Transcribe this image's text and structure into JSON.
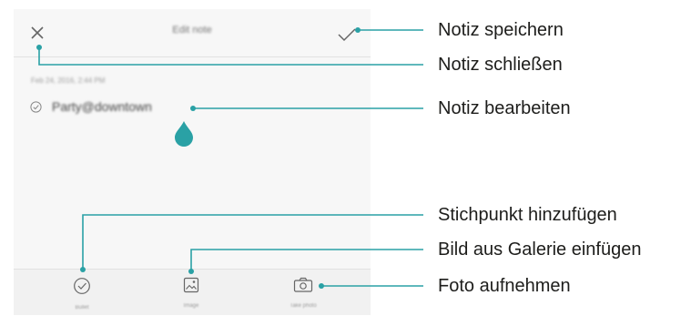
{
  "screen": {
    "title": "Edit note",
    "date": "Feb 24, 2016, 2:44 PM",
    "note_text": "Party@downtown",
    "toolbar": [
      {
        "label": "Bullet",
        "icon": "bullet-check-icon"
      },
      {
        "label": "Image",
        "icon": "image-icon"
      },
      {
        "label": "Take photo",
        "icon": "camera-icon"
      }
    ]
  },
  "callouts": {
    "save": "Notiz speichern",
    "close": "Notiz schließen",
    "edit": "Notiz bearbeiten",
    "bullet": "Stichpunkt hinzufügen",
    "image": "Bild aus Galerie einfügen",
    "photo": "Foto aufnehmen"
  },
  "colors": {
    "accent": "#2aa1a5",
    "screen_bg": "#f7f7f7"
  }
}
